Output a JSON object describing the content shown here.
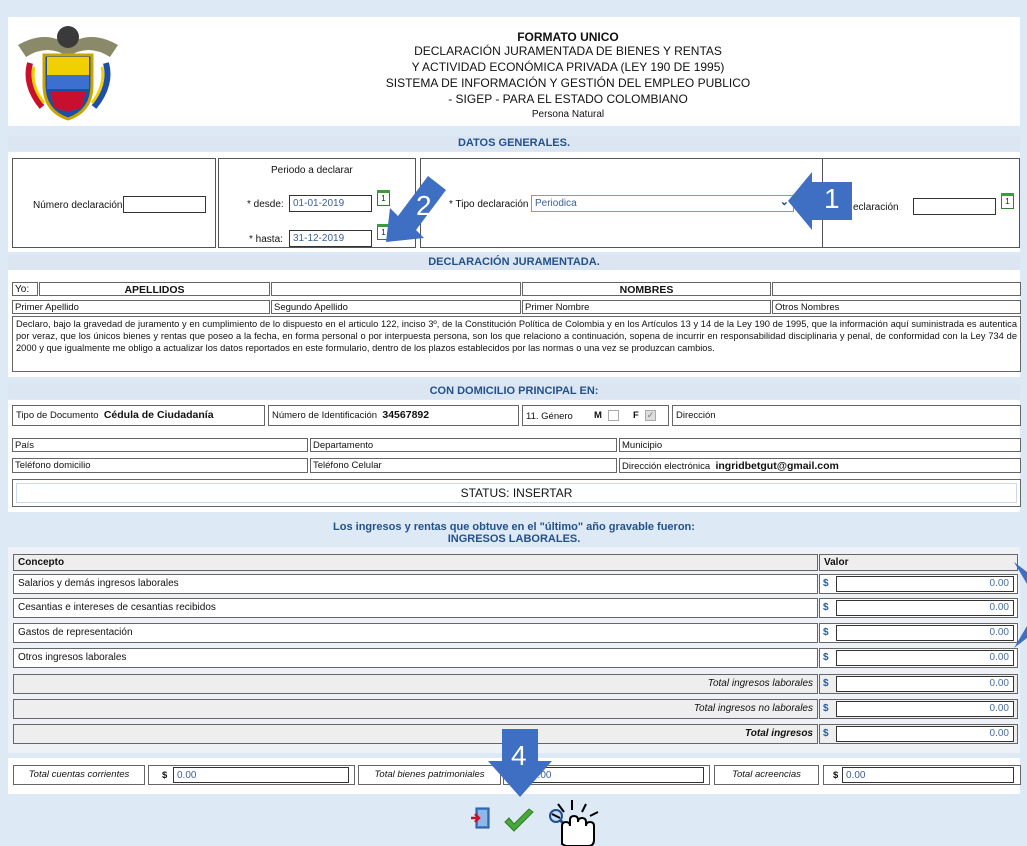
{
  "header": {
    "title": "FORMATO UNICO",
    "lines": [
      "DECLARACIÓN JURAMENTADA DE BIENES Y RENTAS",
      "Y ACTIVIDAD ECONÓMICA PRIVADA (LEY 190 DE 1995)",
      "SISTEMA DE INFORMACIÓN Y GESTIÓN DEL EMPLEO PUBLICO",
      "- SIGEP - PARA EL ESTADO COLOMBIANO"
    ],
    "subtitle": "Persona Natural"
  },
  "general": {
    "section_title": "DATOS GENERALES.",
    "numero_label": "Número declaración:",
    "numero_value": "",
    "periodo_label": "Periodo a declarar",
    "desde_label": "* desde:",
    "desde_value": "01-01-2019",
    "hasta_label": "* hasta:",
    "hasta_value": "31-12-2019",
    "tipo_label": "* Tipo declaración",
    "tipo_value": "Periodica",
    "fecha_label": "eclaración",
    "fecha_value": ""
  },
  "juramentada": {
    "section_title": "DECLARACIÓN JURAMENTADA.",
    "yo_label": "Yo:",
    "apellidos_header": "APELLIDOS",
    "nombres_header": "NOMBRES",
    "primer_apellido": "Primer Apellido",
    "segundo_apellido": "Segundo Apellido",
    "primer_nombre": "Primer Nombre",
    "otros_nombres": "Otros Nombres",
    "declaracion_text": "Declaro, bajo la gravedad de juramento y en cumplimiento de lo dispuesto en el articulo 122, inciso 3º, de la Constitución Política de Colombia y en los Artículos 13 y 14 de la Ley 190 de 1995, que la información aquí suministrada es autentica por veraz, que los únicos bienes y rentas que poseo a la fecha, en forma personal o por interpuesta persona, son los que relaciono a continuación, sopena de incurrir en responsabilidad disciplinaria y penal, de conformidad con la Ley 734 de 2000 y que igualmente me obligo a actualizar los datos reportados en este formulario, dentro de los plazos establecidos por las normas o una vez se produzcan cambios."
  },
  "domicilio": {
    "section_title": "CON DOMICILIO PRINCIPAL EN:",
    "tipo_doc_label": "Tipo de Documento",
    "tipo_doc_value": "Cédula de Ciudadanía",
    "num_id_label": "Número de Identificación",
    "num_id_value": "34567892",
    "genero_label": "11. Género",
    "genero_m": "M",
    "genero_f": "F",
    "direccion_label": "Dirección",
    "pais_label": "País",
    "departamento_label": "Departamento",
    "municipio_label": "Municipio",
    "telefono_label": "Teléfono domicilio",
    "celular_label": "Teléfono Celular",
    "email_label": "Dirección electrónica",
    "email_value": "ingridbetgut@gmail.com",
    "status": "STATUS: INSERTAR"
  },
  "ingresos": {
    "title_line1": "Los ingresos y rentas que obtuve en el \"último\" año gravable fueron:",
    "title_line2": "INGRESOS LABORALES.",
    "col_concepto": "Concepto",
    "col_valor": "Valor",
    "currency": "$",
    "rows": [
      {
        "label": "Salarios y demás ingresos laborales",
        "value": "0.00"
      },
      {
        "label": "Cesantias e intereses de cesantias recibidos",
        "value": "0.00"
      },
      {
        "label": "Gastos de representación",
        "value": "0.00"
      },
      {
        "label": "Otros ingresos laborales",
        "value": "0.00"
      }
    ],
    "totals": [
      {
        "label": "Total ingresos laborales",
        "value": "0.00"
      },
      {
        "label": "Total ingresos no laborales",
        "value": "0.00"
      },
      {
        "label": "Total ingresos",
        "value": "0.00"
      }
    ]
  },
  "summary": {
    "cuentas_label": "Total cuentas corrientes",
    "cuentas_value": "0.00",
    "bienes_label": "Total bienes patrimoniales",
    "bienes_value": "0.00",
    "acreencias_label": "Total acreencias",
    "acreencias_value": "0.00",
    "currency": "$"
  },
  "callouts": {
    "one": "1",
    "two": "2",
    "four": "4"
  },
  "colors": {
    "page_bg": "#dde9f5",
    "section_bar": "#dbe6f2",
    "section_text": "#24518a",
    "callout": "#3f6fc2"
  }
}
